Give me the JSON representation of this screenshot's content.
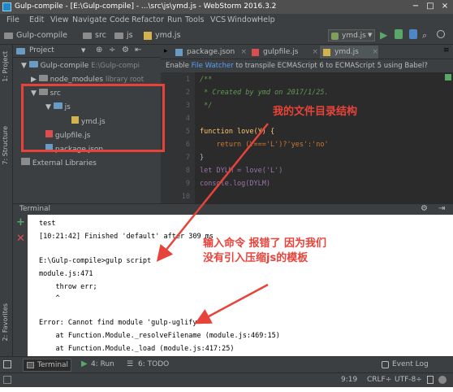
{
  "window": {
    "title": "Gulp-compile - [E:\\Gulp-compile] - ...\\src\\js\\ymd.js - WebStorm 2016.3.2",
    "controls": [
      "−",
      "□",
      "×"
    ]
  },
  "menu": [
    "File",
    "Edit",
    "View",
    "Navigate",
    "Code",
    "Refactor",
    "Run",
    "Tools",
    "VCS",
    "Window",
    "Help"
  ],
  "breadcrumb": [
    "Gulp-compile",
    "src",
    "js",
    "ymd.js"
  ],
  "run_config": "ymd.js",
  "project_panel": {
    "selector": "Project",
    "root": {
      "name": "Gulp-compile",
      "path": "E:\\Gulp-compi"
    },
    "node_modules": {
      "name": "node_modules",
      "suffix": "library root"
    },
    "src": "src",
    "js": "js",
    "ymd": "ymd.js",
    "gulpfile": "gulpfile.js",
    "package": "package.json",
    "external": "External Libraries"
  },
  "sidebar_tabs": {
    "project": "1: Project",
    "structure": "7: Structure",
    "favorites": "2: Favorites"
  },
  "editor": {
    "tabs": [
      "package.json",
      "gulpfile.js",
      "ymd.js"
    ],
    "banner_prefix": "Enable ",
    "banner_link": "File Watcher",
    "banner_suffix": " to transpile ECMAScript 6 to ECMAScript 5 using Babel?",
    "line_numbers": [
      "1",
      "2",
      "3",
      "4",
      "5",
      "6",
      "7",
      "8",
      "9",
      "10"
    ],
    "lines": [
      "/**",
      " * Created by ymd on 2017/1/25.",
      " */",
      "",
      "function love(Y) {",
      "    return (Y==='L')?'yes':'no'",
      "}",
      "let DYLM = love('L')",
      "console.log(DYLM)",
      ""
    ]
  },
  "terminal": {
    "header": "Terminal",
    "lines": [
      "test",
      "[10:21:42] Finished 'default' after 309 ms",
      "",
      "E:\\Gulp-compile>gulp script",
      "module.js:471",
      "    throw err;",
      "    ^",
      "",
      "Error: Cannot find module 'gulp-uglify'",
      "    at Function.Module._resolveFilename (module.js:469:15)",
      "    at Function.Module._load (module.js:417:25)"
    ]
  },
  "bottom_tabs": {
    "terminal": "Terminal",
    "run": "4: Run",
    "todo": "6: TODO",
    "event_log": "Event Log"
  },
  "status": {
    "position": "9:19",
    "line_sep": "CRLF÷",
    "encoding": "UTF-8÷"
  },
  "annotations": {
    "a1": "我的文件目录结构",
    "a2_line1": "输入命令  报错了  因为我们",
    "a2_line2": "没有引入压缩js的模板"
  },
  "colors": {
    "annotation_red": "#e8433a",
    "editor_bg": "#2b2b2b",
    "panel_bg": "#3c3f41"
  }
}
